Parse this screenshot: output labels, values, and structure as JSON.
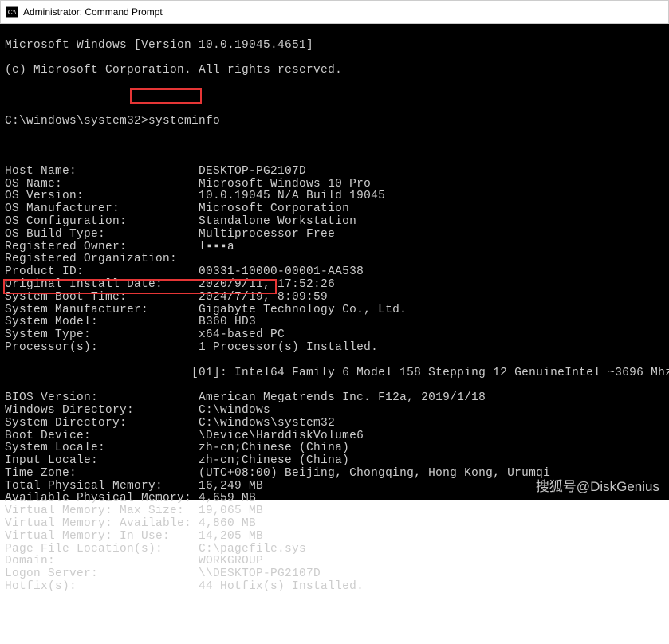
{
  "window": {
    "title": "Administrator: Command Prompt"
  },
  "header": {
    "line1": "Microsoft Windows [Version 10.0.19045.4651]",
    "line2": "(c) Microsoft Corporation. All rights reserved."
  },
  "prompt": {
    "path": "C:\\windows\\system32>",
    "command": "systeminfo"
  },
  "info": [
    {
      "label": "Host Name:",
      "value": "DESKTOP-PG2107D"
    },
    {
      "label": "OS Name:",
      "value": "Microsoft Windows 10 Pro"
    },
    {
      "label": "OS Version:",
      "value": "10.0.19045 N/A Build 19045"
    },
    {
      "label": "OS Manufacturer:",
      "value": "Microsoft Corporation"
    },
    {
      "label": "OS Configuration:",
      "value": "Standalone Workstation"
    },
    {
      "label": "OS Build Type:",
      "value": "Multiprocessor Free"
    },
    {
      "label": "Registered Owner:",
      "value": "l▪▪▪a"
    },
    {
      "label": "Registered Organization:",
      "value": ""
    },
    {
      "label": "Product ID:",
      "value": "00331-10000-00001-AA538"
    },
    {
      "label": "Original Install Date:",
      "value": "2020/9/11, 17:52:26"
    },
    {
      "label": "System Boot Time:",
      "value": "2024/7/19, 8:09:59"
    },
    {
      "label": "System Manufacturer:",
      "value": "Gigabyte Technology Co., Ltd."
    },
    {
      "label": "System Model:",
      "value": "B360 HD3"
    },
    {
      "label": "System Type:",
      "value": "x64-based PC"
    },
    {
      "label": "Processor(s):",
      "value": "1 Processor(s) Installed."
    }
  ],
  "processor_detail": "                          [01]: Intel64 Family 6 Model 158 Stepping 12 GenuineIntel ~3696 Mhz",
  "info2": [
    {
      "label": "BIOS Version:",
      "value": "American Megatrends Inc. F12a, 2019/1/18"
    },
    {
      "label": "Windows Directory:",
      "value": "C:\\windows"
    },
    {
      "label": "System Directory:",
      "value": "C:\\windows\\system32"
    },
    {
      "label": "Boot Device:",
      "value": "\\Device\\HarddiskVolume6"
    },
    {
      "label": "System Locale:",
      "value": "zh-cn;Chinese (China)"
    },
    {
      "label": "Input Locale:",
      "value": "zh-cn;Chinese (China)"
    },
    {
      "label": "Time Zone:",
      "value": "(UTC+08:00) Beijing, Chongqing, Hong Kong, Urumqi"
    },
    {
      "label": "Total Physical Memory:",
      "value": "16,249 MB"
    },
    {
      "label": "Available Physical Memory:",
      "value": "4,659 MB"
    },
    {
      "label": "Virtual Memory: Max Size:",
      "value": "19,065 MB"
    },
    {
      "label": "Virtual Memory: Available:",
      "value": "4,860 MB"
    },
    {
      "label": "Virtual Memory: In Use:",
      "value": "14,205 MB"
    },
    {
      "label": "Page File Location(s):",
      "value": "C:\\pagefile.sys"
    },
    {
      "label": "Domain:",
      "value": "WORKGROUP"
    },
    {
      "label": "Logon Server:",
      "value": "\\\\DESKTOP-PG2107D"
    },
    {
      "label": "Hotfix(s):",
      "value": "44 Hotfix(s) Installed."
    }
  ],
  "watermark": "搜狐号@DiskGenius"
}
